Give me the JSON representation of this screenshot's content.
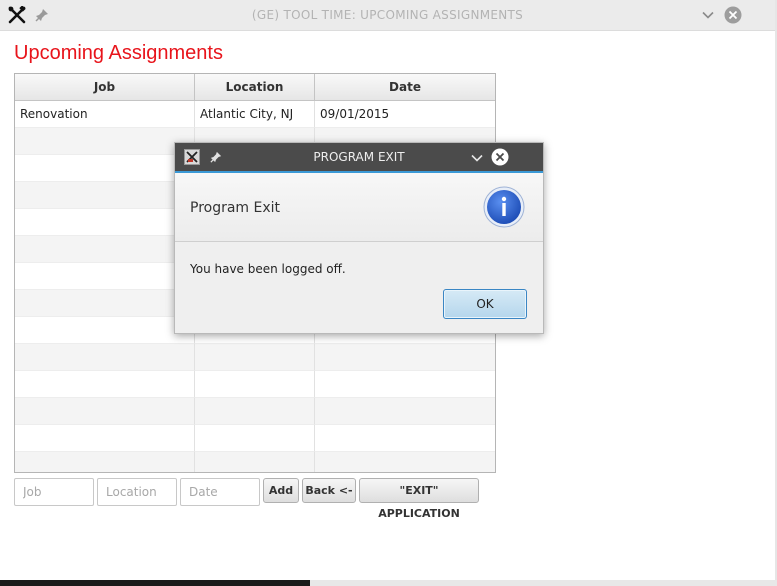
{
  "window": {
    "title": "(GE) TOOL TIME: UPCOMING ASSIGNMENTS",
    "icons": {
      "app": "tools-icon",
      "pin": "pin-icon",
      "minimize": "chevron-down-icon",
      "close": "close-icon"
    }
  },
  "page": {
    "title": "Upcoming Assignments",
    "title_color": "#e8141b"
  },
  "table": {
    "columns": [
      "Job",
      "Location",
      "Date"
    ],
    "rows": [
      {
        "job": "Renovation",
        "location": "Atlantic City, NJ",
        "date": "09/01/2015"
      }
    ]
  },
  "form": {
    "job_placeholder": "Job",
    "location_placeholder": "Location",
    "date_placeholder": "Date",
    "add_label": "Add",
    "back_label": "Back <-",
    "exit_label": "\"EXIT\" APPLICATION"
  },
  "dialog": {
    "title": "PROGRAM EXIT",
    "heading": "Program Exit",
    "message": "You have been logged off.",
    "ok_label": "OK",
    "icon": "info-icon",
    "accent_color": "#3a99d6"
  }
}
